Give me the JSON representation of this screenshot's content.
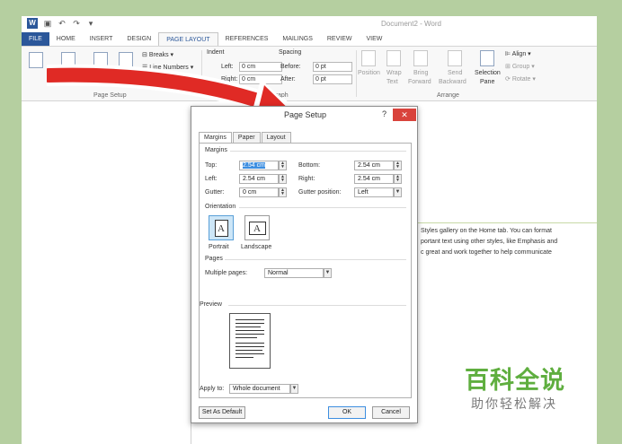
{
  "window": {
    "app_logo": "W",
    "title": "Document2 - Word",
    "quick_access": [
      "save-icon",
      "undo-icon",
      "redo-icon",
      "customize-icon"
    ]
  },
  "ribbon_tabs": [
    "FILE",
    "HOME",
    "INSERT",
    "DESIGN",
    "PAGE LAYOUT",
    "REFERENCES",
    "MAILINGS",
    "REVIEW",
    "VIEW"
  ],
  "active_tab": "PAGE LAYOUT",
  "ribbon": {
    "page_setup": {
      "breaks": "Breaks",
      "line_numbers": "Line Numbers",
      "group_label": "Page Setup"
    },
    "paragraph": {
      "indent": "Indent",
      "spacing": "Spacing",
      "left_label": "Left:",
      "right_label": "Right:",
      "left_value": "0 cm",
      "right_value": "0 cm",
      "before_label": "Before:",
      "after_label": "After:",
      "before_value": "0 pt",
      "after_value": "0 pt",
      "group_label": "Paragraph"
    },
    "arrange": {
      "position": "Position",
      "wrap_text": "Wrap",
      "wrap_text2": "Text",
      "bring_forward": "Bring",
      "bring_forward2": "Forward",
      "send_backward": "Send",
      "send_backward2": "Backward",
      "selection_pane": "Selection",
      "selection_pane2": "Pane",
      "align": "Align",
      "group": "Group",
      "rotate": "Rotate",
      "group_label": "Arrange"
    }
  },
  "document_text": [
    "Styles gallery on the Home tab. You can format",
    "portant text using other styles, like Emphasis and",
    "c great and work together to help communicate"
  ],
  "dialog": {
    "title": "Page Setup",
    "help": "?",
    "close": "✕",
    "tabs": [
      "Margins",
      "Paper",
      "Layout"
    ],
    "active_tab": "Margins",
    "margins_section": "Margins",
    "top_label": "Top:",
    "top_value": "2.54 cm",
    "bottom_label": "Bottom:",
    "bottom_value": "2.54 cm",
    "left_label": "Left:",
    "left_value": "2.54 cm",
    "right_label": "Right:",
    "right_value": "2.54 cm",
    "gutter_label": "Gutter:",
    "gutter_value": "0 cm",
    "gutter_position_label": "Gutter position:",
    "gutter_position_value": "Left",
    "orientation_section": "Orientation",
    "portrait": "Portrait",
    "landscape": "Landscape",
    "selected_orientation": "Portrait",
    "pages_section": "Pages",
    "multiple_pages_label": "Multiple pages:",
    "multiple_pages_value": "Normal",
    "preview_section": "Preview",
    "apply_to_label": "Apply to:",
    "apply_to_value": "Whole document",
    "set_default": "Set As Default",
    "ok": "OK",
    "cancel": "Cancel"
  },
  "watermark": {
    "brand": "百科全说",
    "slogan": "助你轻松解决"
  },
  "colors": {
    "word_blue": "#2b579a",
    "arrow_red": "#e02a25",
    "close_red": "#d9433c",
    "background_green": "#b5cfa0",
    "watermark_green": "#5fae3f"
  }
}
